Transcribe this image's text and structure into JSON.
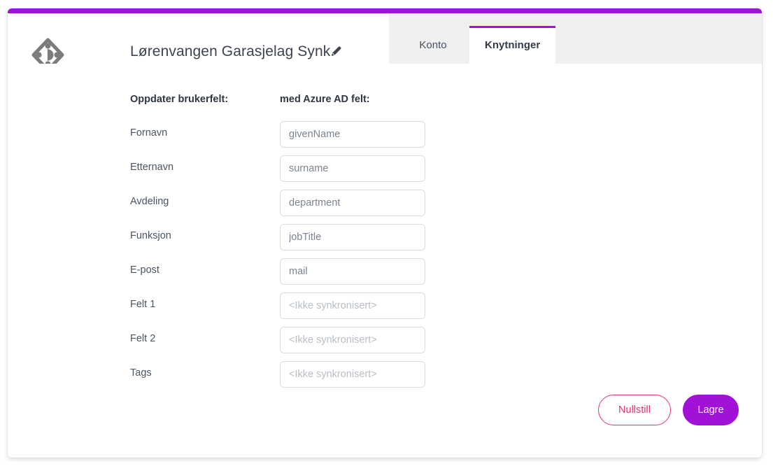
{
  "window": {
    "accent_purple": "#a211d8",
    "accent_pink": "#e8336d",
    "tabstrip_bg": "#f0f0f0"
  },
  "header": {
    "logo_icon": "azure-ad-sync-diamond-icon",
    "title": "Lørenvangen Garasjelag Synk",
    "edit_icon": "pencil-icon"
  },
  "tabs": [
    {
      "label": "Konto",
      "active": false
    },
    {
      "label": "Knytninger",
      "active": true
    }
  ],
  "form": {
    "column_headers": {
      "left": "Oppdater brukerfelt:",
      "right": "med Azure AD felt:"
    },
    "not_synced_text": "<Ikke synkronisert>",
    "rows": [
      {
        "label": "Fornavn",
        "value": "givenName",
        "synced": true
      },
      {
        "label": "Etternavn",
        "value": "surname",
        "synced": true
      },
      {
        "label": "Avdeling",
        "value": "department",
        "synced": true
      },
      {
        "label": "Funksjon",
        "value": "jobTitle",
        "synced": true
      },
      {
        "label": "E-post",
        "value": "mail",
        "synced": true
      },
      {
        "label": "Felt 1",
        "value": "<Ikke synkronisert>",
        "synced": false
      },
      {
        "label": "Felt 2",
        "value": "<Ikke synkronisert>",
        "synced": false
      },
      {
        "label": "Tags",
        "value": "<Ikke synkronisert>",
        "synced": false
      }
    ]
  },
  "actions": {
    "reset_label": "Nullstill",
    "save_label": "Lagre"
  }
}
